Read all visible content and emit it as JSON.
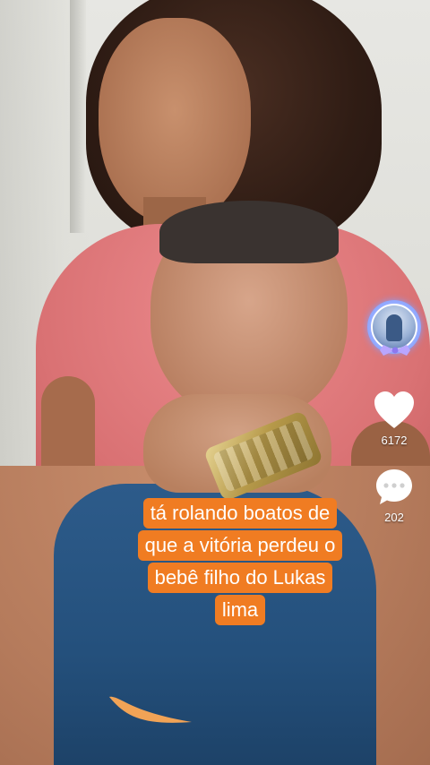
{
  "caption": {
    "lines": [
      "tá rolando boatos de",
      "que a vitória perdeu o",
      "bebê filho do Lukas",
      "lima"
    ]
  },
  "actions": {
    "like_count": "6172",
    "comment_count": "202"
  },
  "icons": {
    "avatar": "profile-avatar-icon",
    "like": "heart-icon",
    "comment": "comment-icon",
    "brand_logo": "swoosh-logo-icon"
  },
  "colors": {
    "caption_bg": "#f07c22",
    "caption_text": "#ffffff",
    "icon_fill": "#ffffff"
  }
}
